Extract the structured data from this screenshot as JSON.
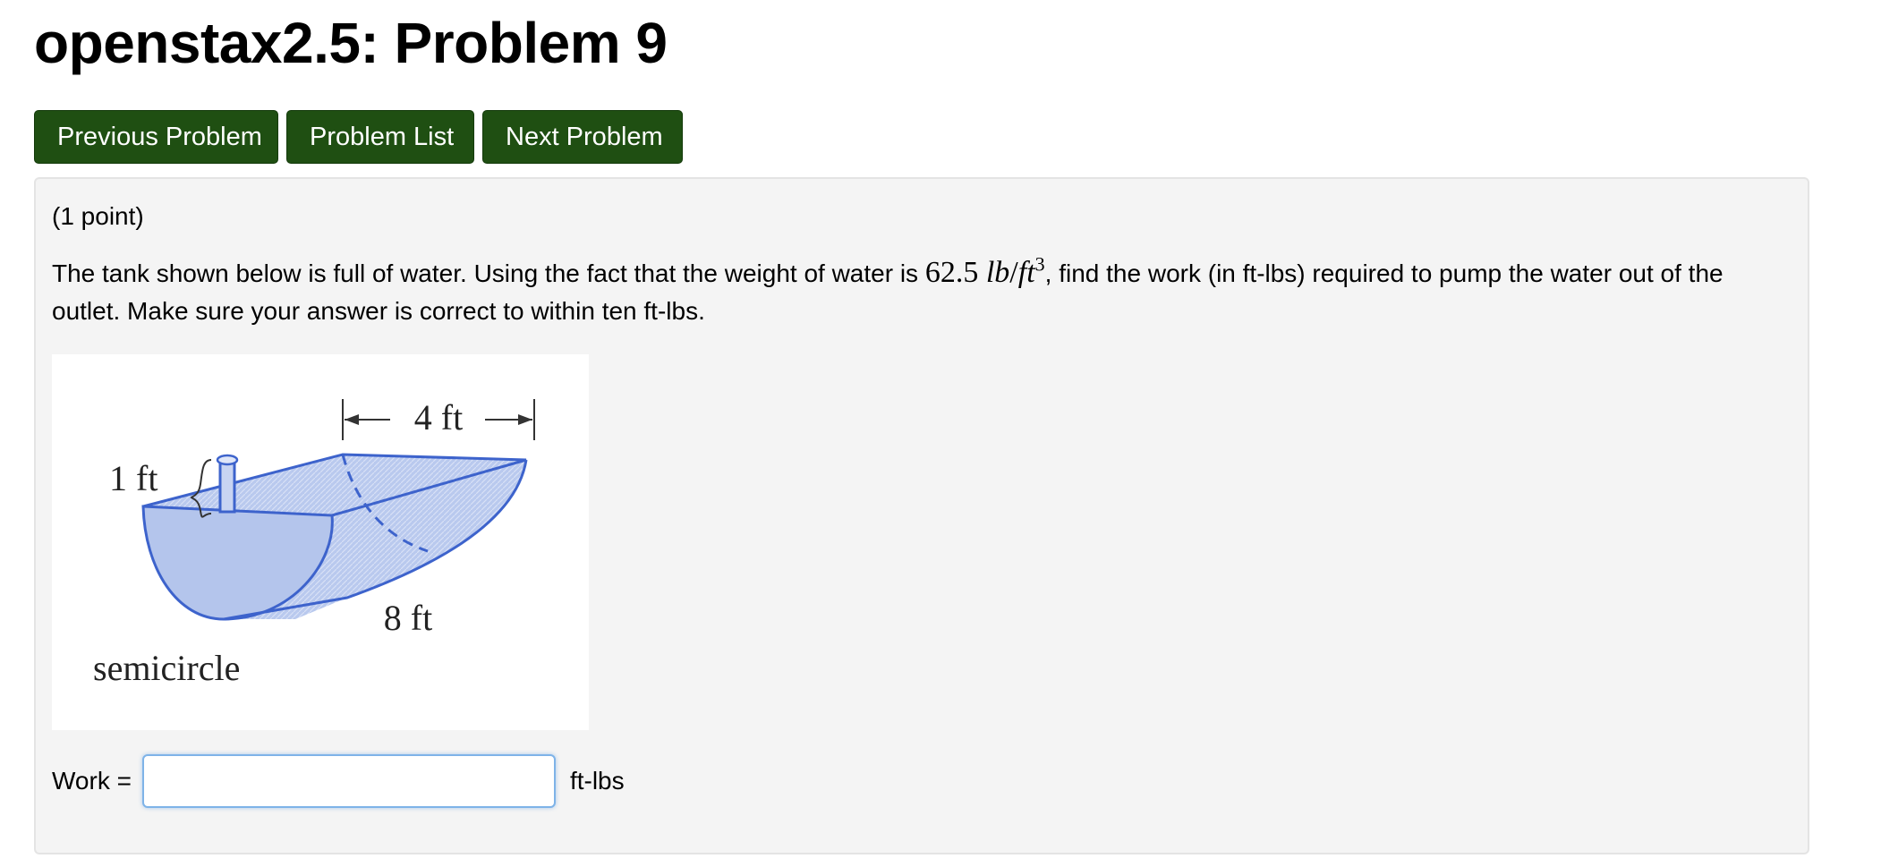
{
  "header": {
    "title": "openstax2.5: Problem 9"
  },
  "nav": {
    "previous_label": "Previous Problem",
    "list_label": "Problem List",
    "next_label": "Next Problem"
  },
  "problem": {
    "points": "(1 point)",
    "text_before": "The tank shown below is full of water. Using the fact that the weight of water is ",
    "math_value": "62.5 ",
    "math_unit_lb": "lb",
    "math_slash": "/",
    "math_unit_ft": "ft",
    "math_exp": "3",
    "text_after": ", find the work (in ft-lbs) required to pump the water out of the outlet. Make sure your answer is correct to within ten ft-lbs.",
    "figure": {
      "label_width": "4 ft",
      "label_height": "1 ft",
      "label_length": "8 ft",
      "label_shape": "semicircle"
    }
  },
  "answer": {
    "label": "Work =",
    "value": "",
    "unit": "ft-lbs"
  },
  "colors": {
    "button_bg": "#1f4f12",
    "panel_bg": "#f4f4f4",
    "tank_fill": "#b8c8ee",
    "tank_stroke": "#3d63cc",
    "input_focus": "#7eb3e8"
  }
}
